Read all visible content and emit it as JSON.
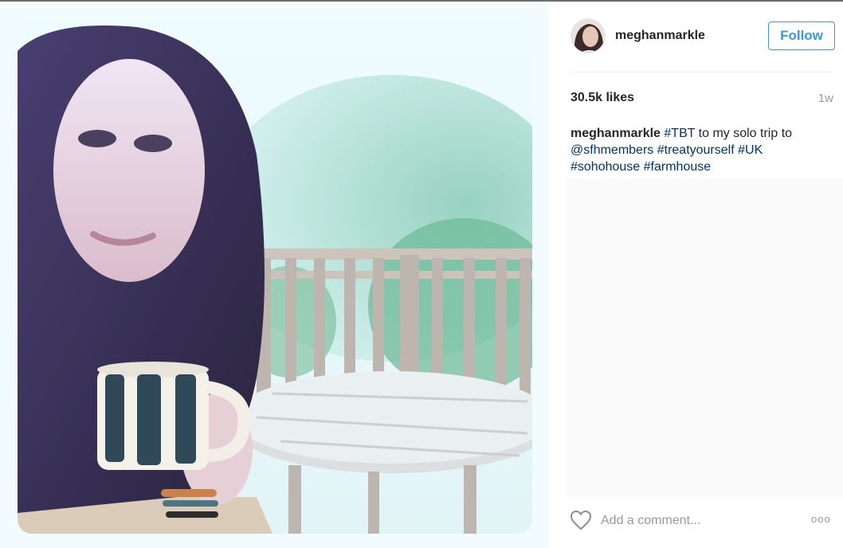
{
  "post": {
    "username": "meghanmarkle",
    "follow_label": "Follow",
    "likes": "30.5k likes",
    "time_ago": "1w",
    "caption": {
      "user": "meghanmarkle",
      "tag_tbt": "#TBT",
      "text_middle": " to my solo trip to ",
      "mention": "@sfhmembers",
      "tag_treat": "#treatyourself",
      "tag_uk": "#UK",
      "tag_soho": "#sohohouse",
      "tag_farm": "#farmhouse"
    }
  },
  "comment": {
    "placeholder": "Add a comment...",
    "more_label": "ooo"
  },
  "icons": {
    "like": "heart-outline-icon",
    "more": "ellipsis-icon"
  },
  "colors": {
    "accent": "#3897f0",
    "hashtag": "#003569",
    "muted": "#999999"
  }
}
